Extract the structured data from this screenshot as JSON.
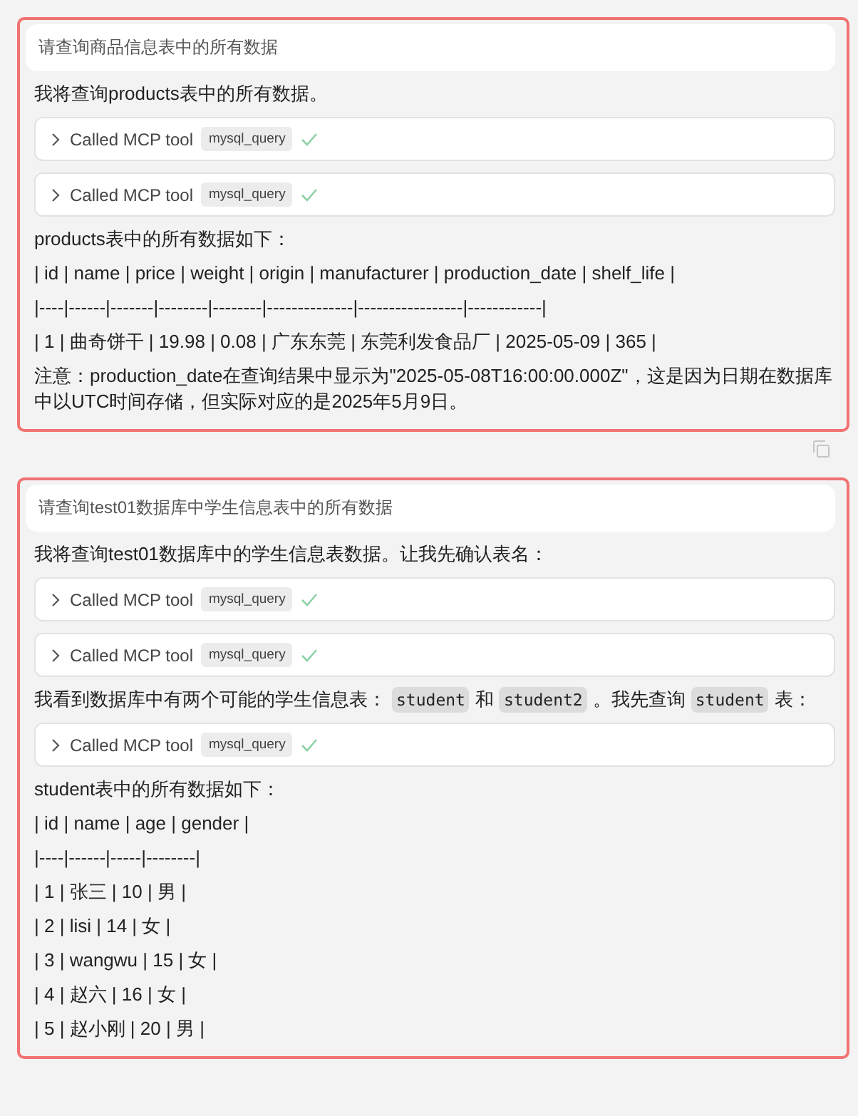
{
  "conversations": [
    {
      "query": "请查询商品信息表中的所有数据",
      "content": [
        {
          "kind": "text",
          "parts": [
            {
              "kind": "plain",
              "text": "我将查询products表中的所有数据。"
            }
          ]
        },
        {
          "kind": "tool",
          "label": "Called MCP tool",
          "tool": "mysql_query",
          "done": true
        },
        {
          "kind": "tool",
          "label": "Called MCP tool",
          "tool": "mysql_query",
          "done": true
        },
        {
          "kind": "text",
          "parts": [
            {
              "kind": "plain",
              "text": "products表中的所有数据如下："
            }
          ]
        },
        {
          "kind": "text",
          "parts": [
            {
              "kind": "plain",
              "text": "| id | name | price | weight | origin | manufacturer | production_date | shelf_life |"
            }
          ]
        },
        {
          "kind": "text",
          "parts": [
            {
              "kind": "plain",
              "text": "|----|------|-------|--------|--------|--------------|-----------------|------------|"
            }
          ]
        },
        {
          "kind": "text",
          "parts": [
            {
              "kind": "plain",
              "text": "| 1 | 曲奇饼干 | 19.98 | 0.08 | 广东东莞 | 东莞利发食品厂 | 2025-05-09 | 365 |"
            }
          ]
        },
        {
          "kind": "text",
          "parts": [
            {
              "kind": "plain",
              "text": "注意：production_date在查询结果中显示为\"2025-05-08T16:00:00.000Z\"，这是因为日期在数据库中以UTC时间存储，但实际对应的是2025年5月9日。"
            }
          ]
        }
      ],
      "copy": true
    },
    {
      "query": "请查询test01数据库中学生信息表中的所有数据",
      "content": [
        {
          "kind": "text",
          "parts": [
            {
              "kind": "plain",
              "text": "我将查询test01数据库中的学生信息表数据。让我先确认表名："
            }
          ]
        },
        {
          "kind": "tool",
          "label": "Called MCP tool",
          "tool": "mysql_query",
          "done": true
        },
        {
          "kind": "tool",
          "label": "Called MCP tool",
          "tool": "mysql_query",
          "done": true
        },
        {
          "kind": "text",
          "parts": [
            {
              "kind": "plain",
              "text": "我看到数据库中有两个可能的学生信息表："
            },
            {
              "kind": "code",
              "text": "student"
            },
            {
              "kind": "plain",
              "text": "和"
            },
            {
              "kind": "code",
              "text": "student2"
            },
            {
              "kind": "plain",
              "text": "。我先查询"
            },
            {
              "kind": "code",
              "text": "student"
            },
            {
              "kind": "plain",
              "text": "表："
            }
          ]
        },
        {
          "kind": "tool",
          "label": "Called MCP tool",
          "tool": "mysql_query",
          "done": true
        },
        {
          "kind": "text",
          "parts": [
            {
              "kind": "plain",
              "text": "student表中的所有数据如下："
            }
          ]
        },
        {
          "kind": "text",
          "parts": [
            {
              "kind": "plain",
              "text": "| id | name | age | gender |"
            }
          ]
        },
        {
          "kind": "text",
          "parts": [
            {
              "kind": "plain",
              "text": "|----|------|-----|--------|"
            }
          ]
        },
        {
          "kind": "text",
          "parts": [
            {
              "kind": "plain",
              "text": "| 1 | 张三 | 10 | 男 |"
            }
          ]
        },
        {
          "kind": "text",
          "parts": [
            {
              "kind": "plain",
              "text": "| 2 | lisi | 14 | 女 |"
            }
          ]
        },
        {
          "kind": "text",
          "parts": [
            {
              "kind": "plain",
              "text": "| 3 | wangwu | 15 | 女 |"
            }
          ]
        },
        {
          "kind": "text",
          "parts": [
            {
              "kind": "plain",
              "text": "| 4 | 赵六 | 16 | 女 |"
            }
          ]
        },
        {
          "kind": "text",
          "parts": [
            {
              "kind": "plain",
              "text": "| 5 | 赵小刚 | 20 | 男 |"
            }
          ]
        }
      ],
      "copy": false
    }
  ]
}
